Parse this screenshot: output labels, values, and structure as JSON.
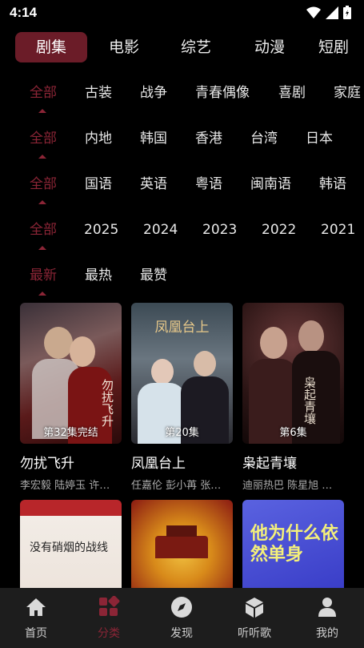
{
  "status": {
    "time": "4:14"
  },
  "tabs": [
    {
      "label": "剧集",
      "active": true
    },
    {
      "label": "电影"
    },
    {
      "label": "综艺"
    },
    {
      "label": "动漫"
    },
    {
      "label": "短剧"
    }
  ],
  "filters": {
    "genre": [
      "全部",
      "古装",
      "战争",
      "青春偶像",
      "喜剧",
      "家庭"
    ],
    "region": [
      "全部",
      "内地",
      "韩国",
      "香港",
      "台湾",
      "日本"
    ],
    "language": [
      "全部",
      "国语",
      "英语",
      "粤语",
      "闽南语",
      "韩语"
    ],
    "year": [
      "全部",
      "2025",
      "2024",
      "2023",
      "2022",
      "2021"
    ],
    "sort": [
      "最新",
      "最热",
      "最赞"
    ]
  },
  "cards": [
    {
      "title": "勿扰飞升",
      "badge": "第32集完结",
      "cast": "李宏毅 陆婷玉 许…",
      "poster_text": "勿扰飞升"
    },
    {
      "title": "凤凰台上",
      "badge": "第20集",
      "cast": "任嘉伦 彭小苒 张…",
      "poster_text": "凤凰台上"
    },
    {
      "title": "枭起青壤",
      "badge": "第6集",
      "cast": "迪丽热巴 陈星旭 …",
      "poster_text": "枭起青壤"
    }
  ],
  "row2_posters": [
    {
      "poster_text": "没有硝烟的战线"
    },
    {
      "poster_text": ""
    },
    {
      "poster_text": "他为什么依然单身"
    }
  ],
  "nav": [
    {
      "label": "首页",
      "icon": "home-icon"
    },
    {
      "label": "分类",
      "icon": "category-icon",
      "active": true
    },
    {
      "label": "发现",
      "icon": "compass-icon"
    },
    {
      "label": "听听歌",
      "icon": "cube-icon"
    },
    {
      "label": "我的",
      "icon": "user-icon"
    }
  ],
  "colors": {
    "accent": "#8b2536",
    "tab_active_bg": "#6b1c28",
    "nav_bg": "#1d1d1d"
  }
}
